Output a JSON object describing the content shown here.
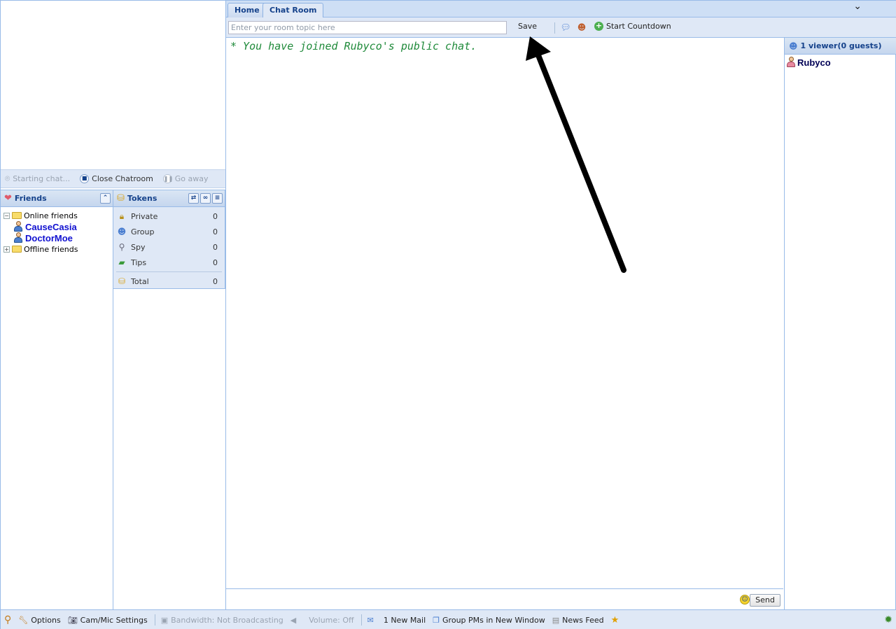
{
  "chat_status": {
    "starting_chat": "Starting chat...",
    "close_chatroom": "Close Chatroom",
    "go_away": "Go away"
  },
  "friends": {
    "title": "Friends",
    "online_label": "Online friends",
    "online": [
      "CauseCasia",
      "DoctorMoe"
    ],
    "offline_label": "Offline friends"
  },
  "tokens": {
    "title": "Tokens",
    "rows": [
      {
        "label": "Private",
        "value": "0",
        "icon": "lock-icon"
      },
      {
        "label": "Group",
        "value": "0",
        "icon": "group-icon"
      },
      {
        "label": "Spy",
        "value": "0",
        "icon": "magnifier-icon"
      },
      {
        "label": "Tips",
        "value": "0",
        "icon": "money-icon"
      }
    ],
    "total_label": "Total",
    "total_value": "0"
  },
  "tabs": {
    "home": "Home",
    "chat_room": "Chat Room"
  },
  "topic": {
    "placeholder": "Enter your room topic here",
    "save_label": "Save",
    "countdown_label": "Start Countdown"
  },
  "chat": {
    "system_message": "* You have joined Rubyco's public chat."
  },
  "input": {
    "send_label": "Send"
  },
  "viewers": {
    "title": "1 viewer(0 guests)",
    "list": [
      "Rubyco"
    ]
  },
  "statusbar": {
    "options": "Options",
    "cam_mic": "Cam/Mic Settings",
    "bandwidth": "Bandwidth: Not Broadcasting",
    "volume": "Volume: Off",
    "mail": "1 New Mail",
    "group_pms": "Group PMs in New Window",
    "news_feed": "News Feed"
  },
  "colors": {
    "panel_bg": "#dfe8f6",
    "border": "#99bbe8",
    "header_text": "#15428b",
    "system_msg": "#1f8a3a",
    "friend_name": "#1010d0",
    "annotation_arrow": "#000000"
  }
}
